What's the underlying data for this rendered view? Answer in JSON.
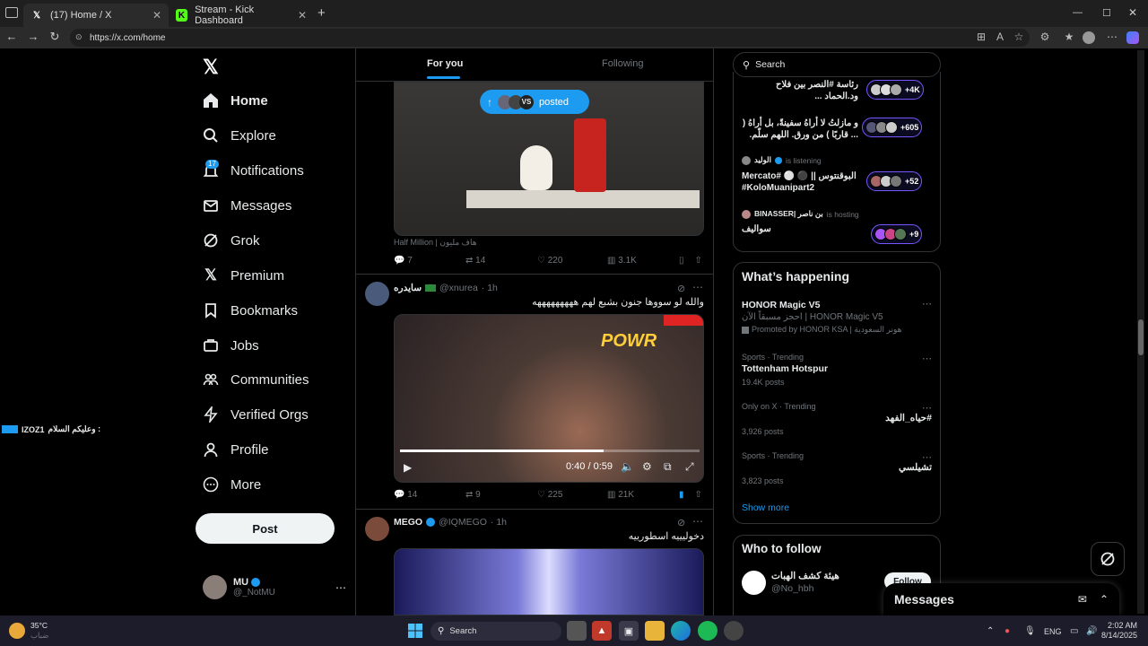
{
  "browser": {
    "tabs": [
      {
        "title": "(17) Home / X",
        "icon": "x-logo-icon"
      },
      {
        "title": "Stream - Kick Dashboard",
        "icon": "kick-logo-icon"
      }
    ],
    "url": "https://x.com/home"
  },
  "sidebar": {
    "items": [
      {
        "label": "Home",
        "icon": "home-icon"
      },
      {
        "label": "Explore",
        "icon": "search-icon"
      },
      {
        "label": "Notifications",
        "icon": "bell-icon",
        "badge": "17"
      },
      {
        "label": "Messages",
        "icon": "mail-icon"
      },
      {
        "label": "Grok",
        "icon": "grok-icon"
      },
      {
        "label": "Premium",
        "icon": "x-logo-icon"
      },
      {
        "label": "Bookmarks",
        "icon": "bookmark-icon"
      },
      {
        "label": "Jobs",
        "icon": "briefcase-icon"
      },
      {
        "label": "Communities",
        "icon": "people-icon"
      },
      {
        "label": "Verified Orgs",
        "icon": "lightning-icon"
      },
      {
        "label": "Profile",
        "icon": "person-icon"
      },
      {
        "label": "More",
        "icon": "more-circle-icon"
      }
    ],
    "post_label": "Post",
    "account": {
      "name": "MU",
      "handle": "@_NotMU"
    }
  },
  "overlay_chat": {
    "user": "IZOZ1",
    "message": "وعليكم السلام :"
  },
  "feed": {
    "tabs": {
      "for_you": "For you",
      "following": "Following"
    },
    "new_posts_pill": {
      "label": "posted",
      "vs": "VS"
    },
    "post1": {
      "caption": "Half Million | هاف مليون",
      "replies": "7",
      "reposts": "14",
      "likes": "220",
      "views": "3.1K"
    },
    "post2": {
      "name": "سايدره",
      "handle": "@xnurea",
      "time": "· 1h",
      "text": "والله لو سووها جنون بشبع لهم هههههههههه",
      "video_time": "0:40 / 0:59",
      "video_progress": 0.68,
      "replies": "14",
      "reposts": "9",
      "likes": "225",
      "views": "21K"
    },
    "post3": {
      "name": "MEGO",
      "handle": "@IQMEGO",
      "time": "· 1h",
      "text": "دخوليييه اسطورييه"
    }
  },
  "right": {
    "search_placeholder": "Search",
    "spaces": [
      {
        "title_line1": "رئاسة #النصر بين فلاح",
        "title_line2": "ود.الحماد ...",
        "count": "+4K"
      },
      {
        "title_line1": "و مازلتُ لا أراهُ سفينةً، بل أراهُ (",
        "title_line2": "... قاربًا ) من ورق. اللهم سلّم.",
        "count": "+605"
      },
      {
        "host": "الوليد",
        "status": "is listening",
        "title_line1": "البوقنتوس || ⚫ ⚪ #Mercato",
        "title_line2": "#KoloMuanipart2",
        "count": "+52"
      },
      {
        "host": "BINASSER| بن ناصر",
        "status": "is hosting",
        "title_line1": "سواليف",
        "count": "+9"
      }
    ],
    "happening": {
      "title": "What’s happening",
      "trends": [
        {
          "meta": "",
          "title": "HONOR Magic V5",
          "sub": "احجز مسبقاً الآن | HONOR Magic V5",
          "promo": "Promoted by HONOR KSA | هونر السعودية"
        },
        {
          "meta": "Sports · Trending",
          "title": "Tottenham Hotspur",
          "sub": "19.4K posts"
        },
        {
          "meta": "Only on X · Trending",
          "title": "#حياه_الفهد",
          "sub": "3,926 posts"
        },
        {
          "meta": "Sports · Trending",
          "title": "تشيلسي",
          "sub": "3,823 posts"
        }
      ],
      "show_more": "Show more"
    },
    "who_to_follow": {
      "title": "Who to follow",
      "users": [
        {
          "name": "هيئة كشف الهبات",
          "handle": "@No_hbh",
          "button": "Follow"
        }
      ]
    },
    "messages_drawer": "Messages"
  },
  "taskbar": {
    "weather_temp": "35°C",
    "weather_desc": "ضباب",
    "search_label": "Search",
    "lang": "ENG",
    "time": "2:02 AM",
    "date": "8/14/2025"
  }
}
